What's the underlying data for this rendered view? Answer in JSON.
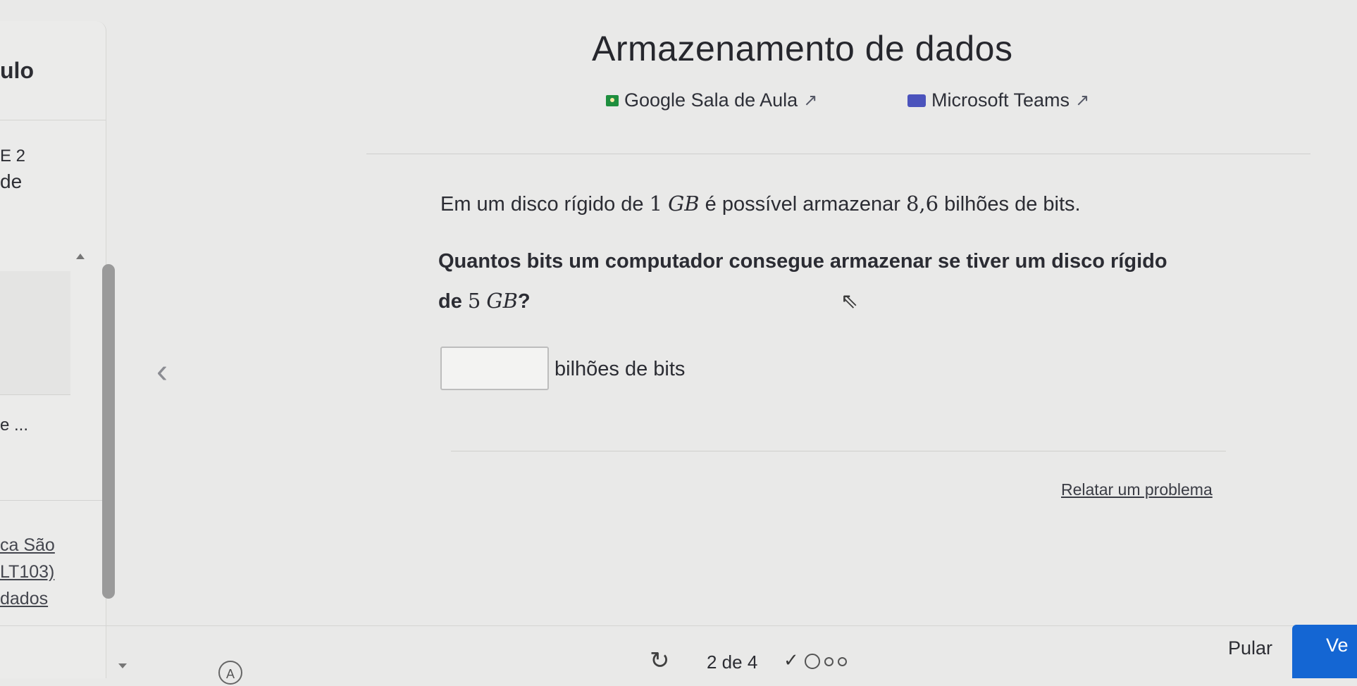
{
  "sidebar": {
    "module_label": "ulo",
    "section": "E 2",
    "section_title": "de",
    "item_label": "e ...",
    "link_lines": [
      "ca São",
      "LT103)",
      "dados"
    ]
  },
  "header": {
    "title": "Armazenamento de dados",
    "links": [
      {
        "label": "Google Sala de Aula",
        "icon": "google-classroom-icon",
        "external": "↗"
      },
      {
        "label": "Microsoft Teams",
        "icon": "microsoft-teams-icon",
        "external": "↗"
      }
    ]
  },
  "question": {
    "statement_pre": "Em um disco rígido de",
    "statement_num": "1",
    "statement_unit": "GB",
    "statement_post": "é possível armazenar",
    "statement_value": "8,6",
    "statement_end": "bilhões de bits.",
    "prompt_line1": "Quantos bits um computador consegue armazenar se tiver um disco rígido",
    "prompt_de": "de",
    "prompt_num": "5",
    "prompt_unit": "GB",
    "prompt_q": "?",
    "answer_value": "",
    "answer_unit": "bilhões de bits"
  },
  "report_problem": "Relatar um problema",
  "footer": {
    "progress": "2 de 4",
    "skip": "Pular",
    "verify": "Ve",
    "avatar_letter": "A"
  },
  "colors": {
    "accent": "#1466d3",
    "background": "#e9e9e8"
  }
}
